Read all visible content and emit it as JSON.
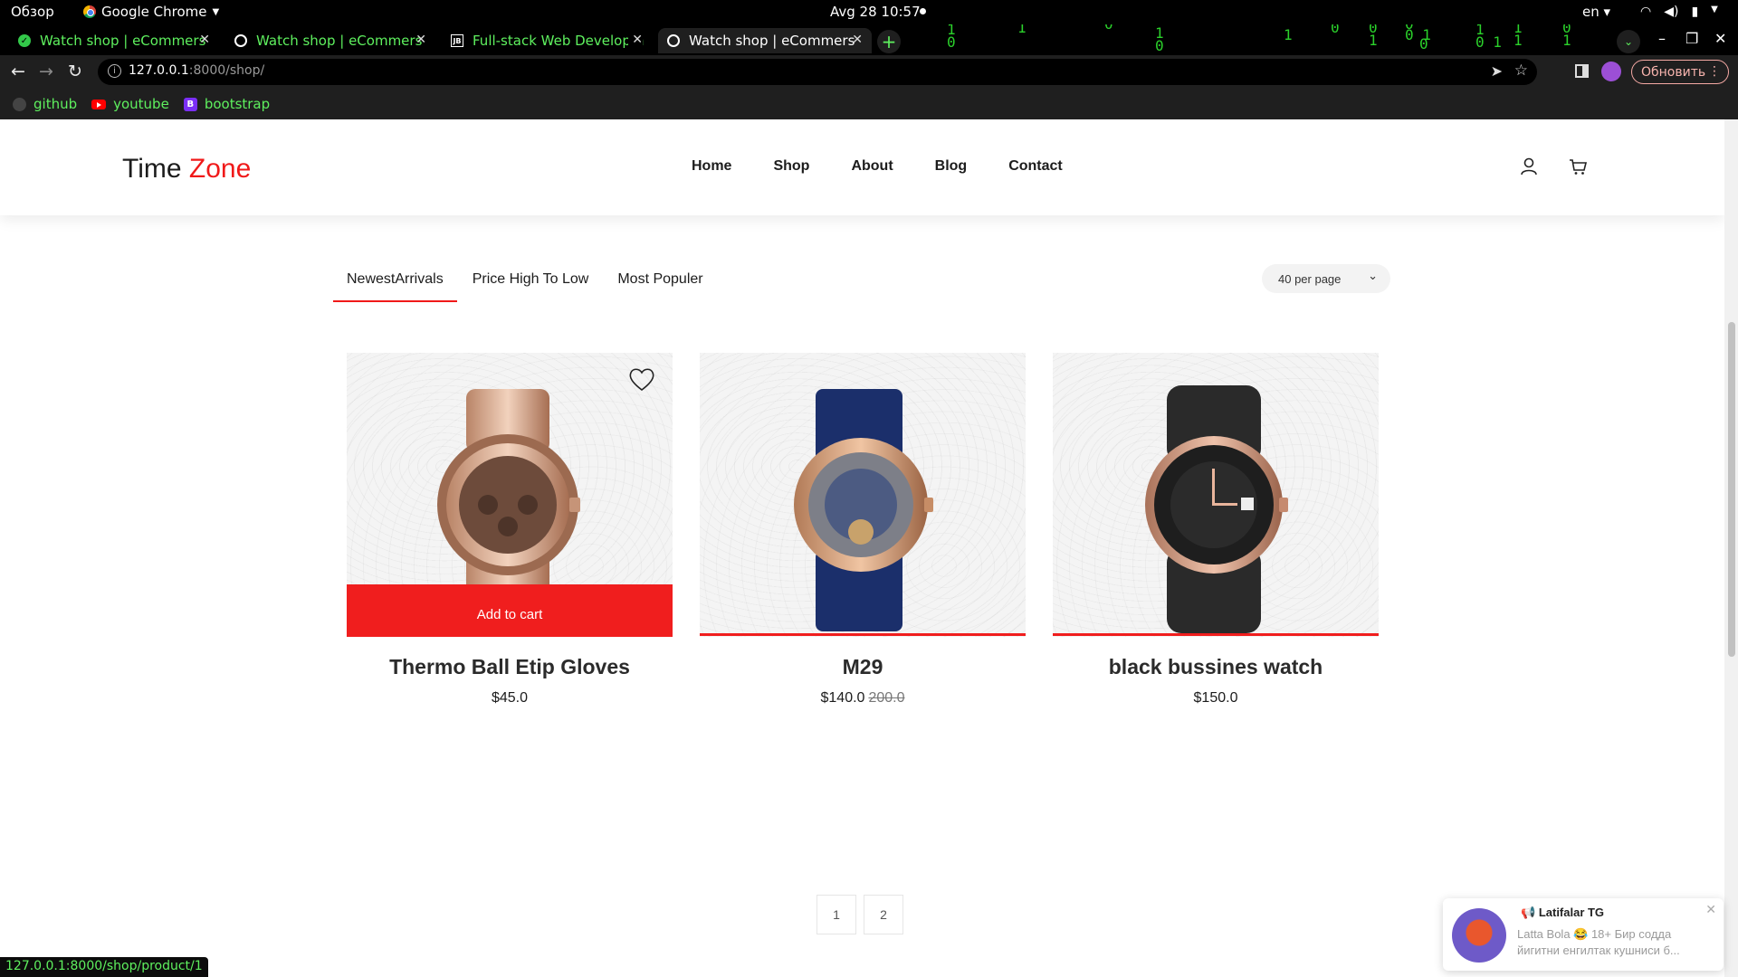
{
  "os": {
    "overview": "Обзор",
    "app_name": "Google Chrome",
    "clock": "Avg 28  10:57",
    "language": "en"
  },
  "tabs": [
    {
      "title": "Watch shop | eCommers",
      "icon": "check-icon",
      "active": false
    },
    {
      "title": "Watch shop | eCommers",
      "icon": "globe-icon",
      "active": false
    },
    {
      "title": "Full-stack Web Developm",
      "icon": "jetbrains-icon",
      "active": false
    },
    {
      "title": "Watch shop | eCommers",
      "icon": "globe-icon",
      "active": true
    }
  ],
  "address": {
    "host": "127.0.0.1",
    "path": ":8000/shop/",
    "update_label": "Обновить"
  },
  "bookmarks": [
    {
      "label": "github",
      "icon": "github-icon"
    },
    {
      "label": "youtube",
      "icon": "youtube-icon"
    },
    {
      "label": "bootstrap",
      "icon": "bootstrap-icon"
    }
  ],
  "site": {
    "logo_part1": "Time",
    "logo_part2": "Zone",
    "accent_color": "#f01919",
    "nav": [
      "Home",
      "Shop",
      "About",
      "Blog",
      "Contact"
    ]
  },
  "filters": {
    "tabs": [
      "NewestArrivals",
      "Price High To Low",
      "Most Populer"
    ],
    "active_index": 0,
    "per_page": "40 per page"
  },
  "products": [
    {
      "name": "Thermo Ball Etip Gloves",
      "price": "$45.0",
      "old_price": "",
      "add_to_cart": "Add to cart",
      "hovered": true
    },
    {
      "name": "M29",
      "price": "$140.0",
      "old_price": "200.0",
      "add_to_cart": "",
      "hovered": false
    },
    {
      "name": "black bussines watch",
      "price": "$150.0",
      "old_price": "",
      "add_to_cart": "",
      "hovered": false
    }
  ],
  "pagination": [
    "1",
    "2"
  ],
  "status_url": "127.0.0.1:8000/shop/product/1",
  "notification": {
    "title": "Latifalar TG",
    "body": "Latta Bola 😂 18+  Бир содда йигитни енгилтак кушниси б..."
  }
}
